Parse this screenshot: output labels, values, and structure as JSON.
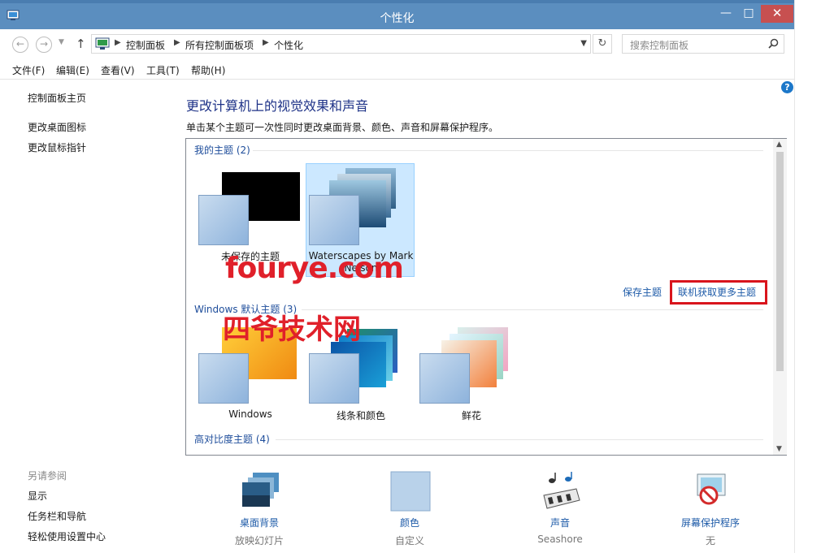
{
  "window": {
    "title": "个性化",
    "minimize": "—",
    "maximize": "□",
    "close": "✕"
  },
  "address": {
    "crumbs": [
      "控制面板",
      "所有控制面板项",
      "个性化"
    ],
    "search_placeholder": "搜索控制面板"
  },
  "menu": [
    "文件(F)",
    "编辑(E)",
    "查看(V)",
    "工具(T)",
    "帮助(H)"
  ],
  "sidebar": {
    "home": "控制面板主页",
    "links": [
      "更改桌面图标",
      "更改鼠标指针"
    ],
    "see_also_heading": "另请参阅",
    "see_also": [
      "显示",
      "任务栏和导航",
      "轻松使用设置中心"
    ]
  },
  "main": {
    "heading": "更改计算机上的视觉效果和声音",
    "description": "单击某个主题可一次性同时更改桌面背景、颜色、声音和屏幕保护程序。",
    "groups": {
      "my_themes": "我的主题 (2)",
      "windows_default": "Windows 默认主题 (3)",
      "high_contrast": "高对比度主题 (4)"
    },
    "my_themes": [
      {
        "name": "未保存的主题",
        "selected": false
      },
      {
        "name": "Waterscapes by Mark Nelson",
        "selected": true
      }
    ],
    "default_themes": [
      {
        "name": "Windows"
      },
      {
        "name": "线条和颜色"
      },
      {
        "name": "鲜花"
      }
    ],
    "save_theme": "保存主题",
    "online_themes": "联机获取更多主题"
  },
  "watermark": {
    "line1": "fourye.com",
    "line2": "四爷技术网"
  },
  "bottom": [
    {
      "label": "桌面背景",
      "sub": "放映幻灯片"
    },
    {
      "label": "颜色",
      "sub": "自定义"
    },
    {
      "label": "声音",
      "sub": "Seashore"
    },
    {
      "label": "屏幕保护程序",
      "sub": "无"
    }
  ],
  "colors": {
    "link": "#1e5ba8",
    "heading": "#1e3287",
    "highlight_box": "#d9141c",
    "titlebar": "#5b8ebf"
  }
}
